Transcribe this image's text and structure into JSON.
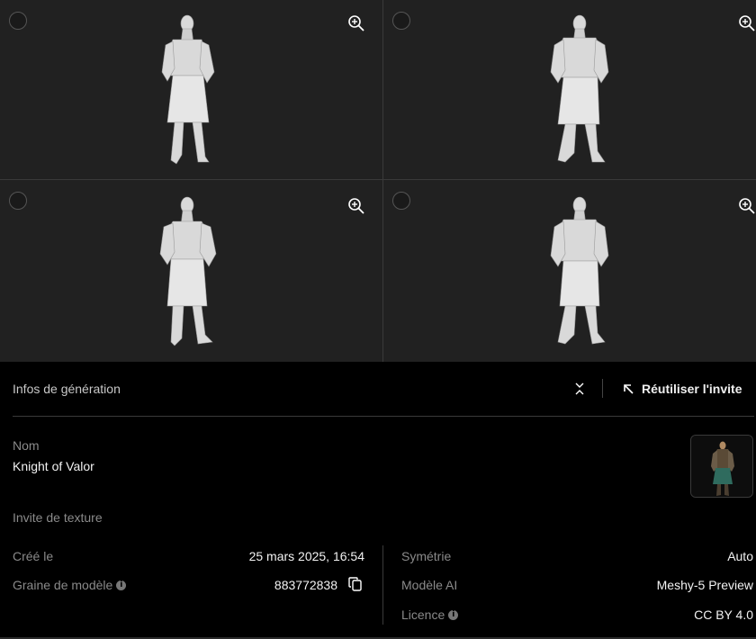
{
  "grid": {
    "cells": [
      {
        "zoom_icon": "zoom-in-icon",
        "select_icon": "select-circle"
      },
      {
        "zoom_icon": "zoom-in-icon",
        "select_icon": "select-circle"
      },
      {
        "zoom_icon": "zoom-in-icon",
        "select_icon": "select-circle"
      },
      {
        "zoom_icon": "zoom-in-icon",
        "select_icon": "select-circle"
      }
    ]
  },
  "panel": {
    "title": "Infos de génération",
    "collapse_icon": "collapse-icon",
    "reuse_label": "Réutiliser l'invite",
    "reuse_icon": "arrow-up-left-icon",
    "name_label": "Nom",
    "name_value": "Knight of Valor",
    "texture_label": "Invite de texture",
    "left_rows": [
      {
        "label": "Créé le",
        "value": "25 mars 2025, 16:54"
      },
      {
        "label": "Graine de modèle",
        "value": "883772838",
        "info": true
      }
    ],
    "right_rows": [
      {
        "label": "Symétrie",
        "value": "Auto"
      },
      {
        "label": "Modèle AI",
        "value": "Meshy-5 Preview"
      },
      {
        "label": "Licence",
        "value": "CC BY 4.0",
        "info": true
      }
    ],
    "info_glyph": "i",
    "colors": {
      "background": "#000000",
      "grid_bg": "#212121",
      "label": "#8a8a8a",
      "value": "#f2f2f2"
    }
  }
}
